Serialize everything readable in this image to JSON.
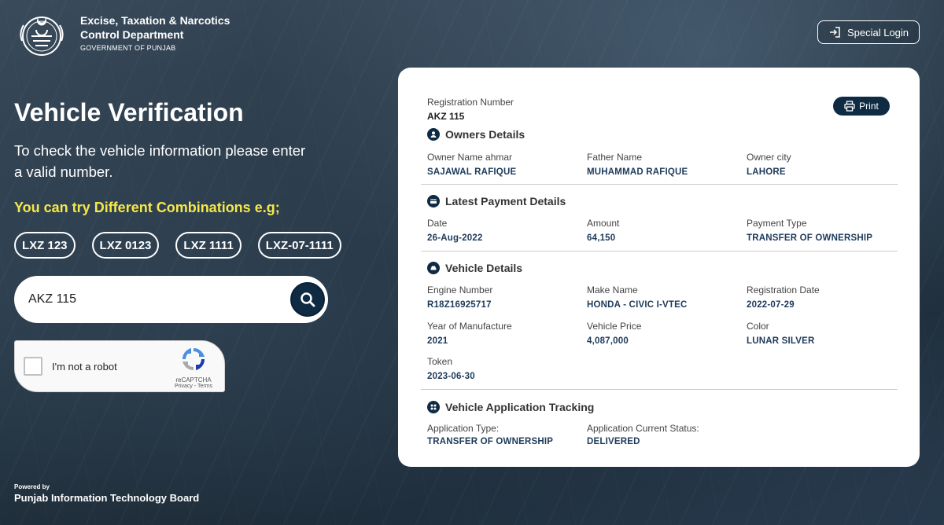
{
  "header": {
    "dept_line1": "Excise, Taxation & Narcotics",
    "dept_line2": "Control Department",
    "govt": "GOVERNMENT OF PUNJAB",
    "special_login": "Special Login"
  },
  "hero": {
    "title": "Vehicle Verification",
    "subtitle": "To check the vehicle information please enter a valid number.",
    "try_text": "You can try Different Combinations e.g;",
    "examples": [
      "LXZ 123",
      "LXZ 0123",
      "LXZ 1111",
      "LXZ-07-1111"
    ]
  },
  "search": {
    "value": "AKZ 115"
  },
  "captcha": {
    "label": "I'm not a robot",
    "brand": "reCAPTCHA",
    "links": "Privacy - Terms"
  },
  "footer": {
    "powered_by": "Powered by",
    "org": "Punjab Information Technology Board"
  },
  "result": {
    "reg_label": "Registration Number",
    "reg_value": "AKZ 115",
    "print_label": "Print",
    "owners": {
      "heading": "Owners Details",
      "fields": [
        {
          "label": "Owner Name ahmar",
          "value": "SAJAWAL RAFIQUE"
        },
        {
          "label": "Father Name",
          "value": "MUHAMMAD RAFIQUE"
        },
        {
          "label": "Owner city",
          "value": "LAHORE"
        }
      ]
    },
    "payment": {
      "heading": "Latest Payment Details",
      "fields": [
        {
          "label": "Date",
          "value": "26-Aug-2022"
        },
        {
          "label": "Amount",
          "value": "64,150"
        },
        {
          "label": "Payment Type",
          "value": "TRANSFER OF OWNERSHIP"
        }
      ]
    },
    "vehicle": {
      "heading": "Vehicle Details",
      "fields": [
        {
          "label": "Engine Number",
          "value": "R18Z16925717"
        },
        {
          "label": "Make Name",
          "value": "HONDA - CIVIC I-VTEC"
        },
        {
          "label": "Registration Date",
          "value": "2022-07-29"
        },
        {
          "label": "Year of Manufacture",
          "value": "2021"
        },
        {
          "label": "Vehicle Price",
          "value": "4,087,000"
        },
        {
          "label": "Color",
          "value": "LUNAR SILVER"
        },
        {
          "label": "Token",
          "value": "2023-06-30"
        }
      ]
    },
    "tracking": {
      "heading": "Vehicle Application Tracking",
      "fields": [
        {
          "label": "Application Type:",
          "value": "TRANSFER OF OWNERSHIP"
        },
        {
          "label": "Application Current Status:",
          "value": "DELIVERED"
        }
      ]
    }
  },
  "colors": {
    "primary": "#0f2b44",
    "accent_yellow": "#f5e84a",
    "value_text": "#1d3a5a"
  },
  "icons": [
    "punjab-logo-icon",
    "login-icon",
    "search-icon",
    "print-icon",
    "user-icon",
    "payment-icon",
    "car-icon",
    "tracking-icon",
    "recaptcha-icon"
  ]
}
